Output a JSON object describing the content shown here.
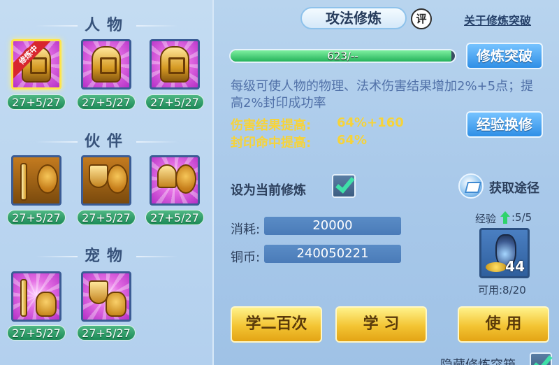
{
  "left": {
    "sections": {
      "character": "人物",
      "partner": "伙伴",
      "pet": "宠物"
    },
    "character_skills": [
      {
        "badge": "修炼中",
        "level": "27+5/27"
      },
      {
        "level": "27+5/27"
      },
      {
        "level": "27+5/27"
      }
    ],
    "partner_skills": [
      {
        "level": "27+5/27"
      },
      {
        "level": "27+5/27"
      },
      {
        "level": "27+5/27"
      }
    ],
    "pet_skills": [
      {
        "level": "27+5/27"
      },
      {
        "level": "27+5/27"
      }
    ]
  },
  "right": {
    "title": "攻法修炼",
    "review_badge": "评",
    "top_link": "关于修炼突破",
    "progress": {
      "text": "623/--",
      "fraction": 0.985
    },
    "breakthrough_button": "修炼突破",
    "description": "每级可使人物的物理、法术伤害结果增加2%+5点；提高2%封印成功率",
    "stats": [
      {
        "label": "伤害结果提高:",
        "value": "64%+160"
      },
      {
        "label": "封印命中提高:",
        "value": "64%"
      }
    ],
    "exchange_button": "经验换修",
    "set_current_label": "设为当前修炼",
    "set_current_checked": true,
    "get_path_label": "获取途径",
    "cost_label": "消耗:",
    "cost_value": "20000",
    "coins_label": "铜币:",
    "coins_value": "240050221",
    "exp_label": "经验",
    "exp_value": ":5/5",
    "item_count": "44",
    "item_available": "可用:8/20",
    "buttons": {
      "learn_hundred": "学二百次",
      "learn": "学 习",
      "use": "使 用"
    },
    "hide_label": "隐藏修炼突箱"
  },
  "colors": {
    "accent_blue": "#2f8fe6",
    "level_green": "#1c8a57",
    "stat_yellow": "#f6d33a",
    "check_teal": "#3fe0a8"
  }
}
